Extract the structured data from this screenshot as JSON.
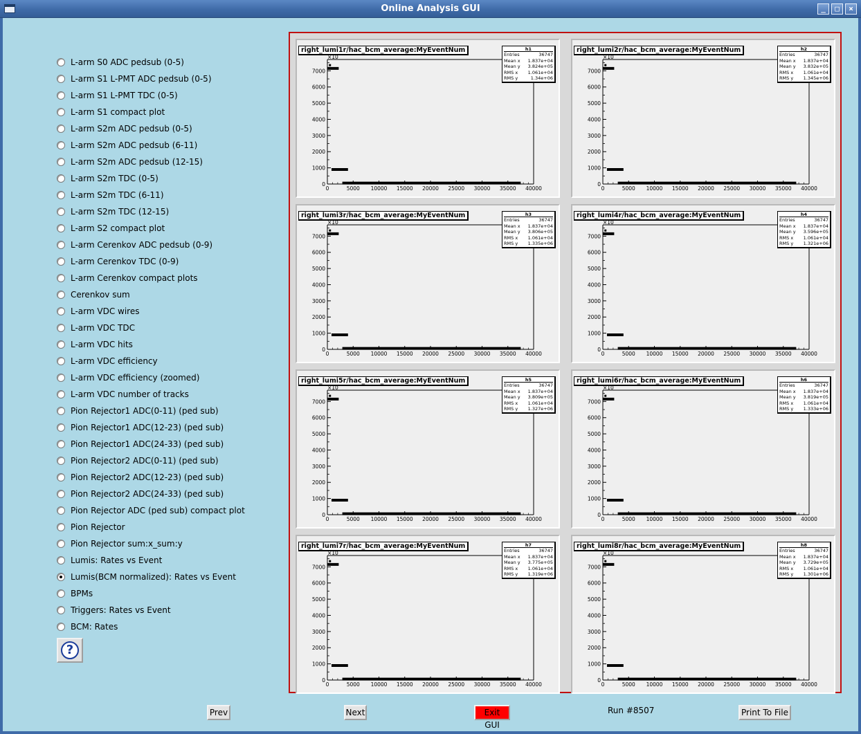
{
  "window": {
    "title": "Online Analysis GUI",
    "minimize_glyph": "_",
    "maximize_glyph": "□",
    "close_glyph": "×"
  },
  "radio_options": [
    {
      "label": "L-arm S0 ADC pedsub (0-5)",
      "checked": false
    },
    {
      "label": "L-arm S1 L-PMT ADC pedsub (0-5)",
      "checked": false
    },
    {
      "label": "L-arm S1 L-PMT TDC (0-5)",
      "checked": false
    },
    {
      "label": "L-arm S1 compact plot",
      "checked": false
    },
    {
      "label": "L-arm S2m ADC pedsub (0-5)",
      "checked": false
    },
    {
      "label": "L-arm S2m ADC pedsub (6-11)",
      "checked": false
    },
    {
      "label": "L-arm S2m ADC pedsub (12-15)",
      "checked": false
    },
    {
      "label": "L-arm S2m TDC (0-5)",
      "checked": false
    },
    {
      "label": "L-arm S2m TDC (6-11)",
      "checked": false
    },
    {
      "label": "L-arm S2m TDC (12-15)",
      "checked": false
    },
    {
      "label": "L-arm S2 compact plot",
      "checked": false
    },
    {
      "label": "L-arm Cerenkov ADC pedsub (0-9)",
      "checked": false
    },
    {
      "label": "L-arm Cerenkov TDC (0-9)",
      "checked": false
    },
    {
      "label": "L-arm Cerenkov compact plots",
      "checked": false
    },
    {
      "label": "Cerenkov sum",
      "checked": false
    },
    {
      "label": "L-arm VDC wires",
      "checked": false
    },
    {
      "label": "L-arm VDC TDC",
      "checked": false
    },
    {
      "label": "L-arm VDC hits",
      "checked": false
    },
    {
      "label": "L-arm VDC efficiency",
      "checked": false
    },
    {
      "label": "L-arm VDC efficiency (zoomed)",
      "checked": false
    },
    {
      "label": "L-arm VDC number of tracks",
      "checked": false
    },
    {
      "label": "Pion Rejector1 ADC(0-11) (ped sub)",
      "checked": false
    },
    {
      "label": "Pion Rejector1 ADC(12-23) (ped sub)",
      "checked": false
    },
    {
      "label": "Pion Rejector1 ADC(24-33) (ped sub)",
      "checked": false
    },
    {
      "label": "Pion Rejector2 ADC(0-11) (ped sub)",
      "checked": false
    },
    {
      "label": "Pion Rejector2 ADC(12-23) (ped sub)",
      "checked": false
    },
    {
      "label": "Pion Rejector2 ADC(24-33) (ped sub)",
      "checked": false
    },
    {
      "label": "Pion Rejector ADC (ped sub) compact plot",
      "checked": false
    },
    {
      "label": "Pion Rejector",
      "checked": false
    },
    {
      "label": "Pion Rejector sum:x_sum:y",
      "checked": false
    },
    {
      "label": "Lumis: Rates vs Event",
      "checked": false
    },
    {
      "label": "Lumis(BCM normalized): Rates vs Event",
      "checked": true
    },
    {
      "label": "BPMs",
      "checked": false
    },
    {
      "label": "Triggers: Rates vs Event",
      "checked": false
    },
    {
      "label": "BCM: Rates",
      "checked": false
    }
  ],
  "help_button": {
    "glyph": "?"
  },
  "chart_data": [
    {
      "type": "scatter",
      "title": "right_lumi1r/hac_bcm_average:MyEventNum",
      "stats_name": "h1",
      "stats": {
        "Entries": "36747",
        "Mean x": "1.837e+04",
        "Mean y": "3.824e+05",
        "RMS x": "1.061e+04",
        "RMS y": "1.34e+06"
      },
      "x_ticks": [
        "0",
        "5000",
        "10000",
        "15000",
        "20000",
        "25000",
        "30000",
        "35000",
        "40000"
      ],
      "y_ticks": [
        "0",
        "1000",
        "2000",
        "3000",
        "4000",
        "5000",
        "6000",
        "7000"
      ],
      "y_multiplier": "×10",
      "xlim": [
        0,
        40000
      ],
      "ylim": [
        0,
        7700
      ]
    },
    {
      "type": "scatter",
      "title": "right_lumi2r/hac_bcm_average:MyEventNum",
      "stats_name": "h2",
      "stats": {
        "Entries": "36747",
        "Mean x": "1.837e+04",
        "Mean y": "3.832e+05",
        "RMS x": "1.061e+04",
        "RMS y": "1.345e+06"
      },
      "x_ticks": [
        "0",
        "5000",
        "10000",
        "15000",
        "20000",
        "25000",
        "30000",
        "35000",
        "40000"
      ],
      "y_ticks": [
        "0",
        "1000",
        "2000",
        "3000",
        "4000",
        "5000",
        "6000",
        "7000"
      ],
      "y_multiplier": "×10",
      "xlim": [
        0,
        40000
      ],
      "ylim": [
        0,
        7700
      ]
    },
    {
      "type": "scatter",
      "title": "right_lumi3r/hac_bcm_average:MyEventNum",
      "stats_name": "h3",
      "stats": {
        "Entries": "36747",
        "Mean x": "1.837e+04",
        "Mean y": "3.806e+05",
        "RMS x": "1.061e+04",
        "RMS y": "1.335e+06"
      },
      "x_ticks": [
        "0",
        "5000",
        "10000",
        "15000",
        "20000",
        "25000",
        "30000",
        "35000",
        "40000"
      ],
      "y_ticks": [
        "0",
        "1000",
        "2000",
        "3000",
        "4000",
        "5000",
        "6000",
        "7000"
      ],
      "y_multiplier": "×10",
      "xlim": [
        0,
        40000
      ],
      "ylim": [
        0,
        7700
      ]
    },
    {
      "type": "scatter",
      "title": "right_lumi4r/hac_bcm_average:MyEventNum",
      "stats_name": "h4",
      "stats": {
        "Entries": "36747",
        "Mean x": "1.837e+04",
        "Mean y": "3.596e+05",
        "RMS x": "1.061e+04",
        "RMS y": "1.321e+06"
      },
      "x_ticks": [
        "0",
        "5000",
        "10000",
        "15000",
        "20000",
        "25000",
        "30000",
        "35000",
        "40000"
      ],
      "y_ticks": [
        "0",
        "1000",
        "2000",
        "3000",
        "4000",
        "5000",
        "6000",
        "7000"
      ],
      "y_multiplier": "×10",
      "xlim": [
        0,
        40000
      ],
      "ylim": [
        0,
        7700
      ]
    },
    {
      "type": "scatter",
      "title": "right_lumi5r/hac_bcm_average:MyEventNum",
      "stats_name": "h5",
      "stats": {
        "Entries": "36747",
        "Mean x": "1.837e+04",
        "Mean y": "3.809e+05",
        "RMS x": "1.061e+04",
        "RMS y": "1.327e+06"
      },
      "x_ticks": [
        "0",
        "5000",
        "10000",
        "15000",
        "20000",
        "25000",
        "30000",
        "35000",
        "40000"
      ],
      "y_ticks": [
        "0",
        "1000",
        "2000",
        "3000",
        "4000",
        "5000",
        "6000",
        "7000"
      ],
      "y_multiplier": "×10",
      "xlim": [
        0,
        40000
      ],
      "ylim": [
        0,
        7700
      ]
    },
    {
      "type": "scatter",
      "title": "right_lumi6r/hac_bcm_average:MyEventNum",
      "stats_name": "h6",
      "stats": {
        "Entries": "36747",
        "Mean x": "1.837e+04",
        "Mean y": "3.819e+05",
        "RMS x": "1.061e+04",
        "RMS y": "1.333e+06"
      },
      "x_ticks": [
        "0",
        "5000",
        "10000",
        "15000",
        "20000",
        "25000",
        "30000",
        "35000",
        "40000"
      ],
      "y_ticks": [
        "0",
        "1000",
        "2000",
        "3000",
        "4000",
        "5000",
        "6000",
        "7000"
      ],
      "y_multiplier": "×10",
      "xlim": [
        0,
        40000
      ],
      "ylim": [
        0,
        7700
      ]
    },
    {
      "type": "scatter",
      "title": "right_lumi7r/hac_bcm_average:MyEventNum",
      "stats_name": "h7",
      "stats": {
        "Entries": "36747",
        "Mean x": "1.837e+04",
        "Mean y": "3.775e+05",
        "RMS x": "1.061e+04",
        "RMS y": "1.319e+06"
      },
      "x_ticks": [
        "0",
        "5000",
        "10000",
        "15000",
        "20000",
        "25000",
        "30000",
        "35000",
        "40000"
      ],
      "y_ticks": [
        "0",
        "1000",
        "2000",
        "3000",
        "4000",
        "5000",
        "6000",
        "7000"
      ],
      "y_multiplier": "×10",
      "xlim": [
        0,
        40000
      ],
      "ylim": [
        0,
        7700
      ]
    },
    {
      "type": "scatter",
      "title": "right_lumi8r/hac_bcm_average:MyEventNum",
      "stats_name": "h8",
      "stats": {
        "Entries": "36747",
        "Mean x": "1.837e+04",
        "Mean y": "3.729e+05",
        "RMS x": "1.061e+04",
        "RMS y": "1.301e+06"
      },
      "x_ticks": [
        "0",
        "5000",
        "10000",
        "15000",
        "20000",
        "25000",
        "30000",
        "35000",
        "40000"
      ],
      "y_ticks": [
        "0",
        "1000",
        "2000",
        "3000",
        "4000",
        "5000",
        "6000",
        "7000"
      ],
      "y_multiplier": "×10",
      "xlim": [
        0,
        40000
      ],
      "ylim": [
        0,
        7700
      ]
    }
  ],
  "controls": {
    "prev_label": "Prev",
    "next_label": "Next",
    "exit_label": "Exit GUI",
    "run_label": "Run #8507",
    "print_label": "Print To File"
  },
  "colors": {
    "background": "#add8e6",
    "canvas_border": "#c01010",
    "exit_button": "#ff0000",
    "titlebar": "#3f6ba8"
  }
}
